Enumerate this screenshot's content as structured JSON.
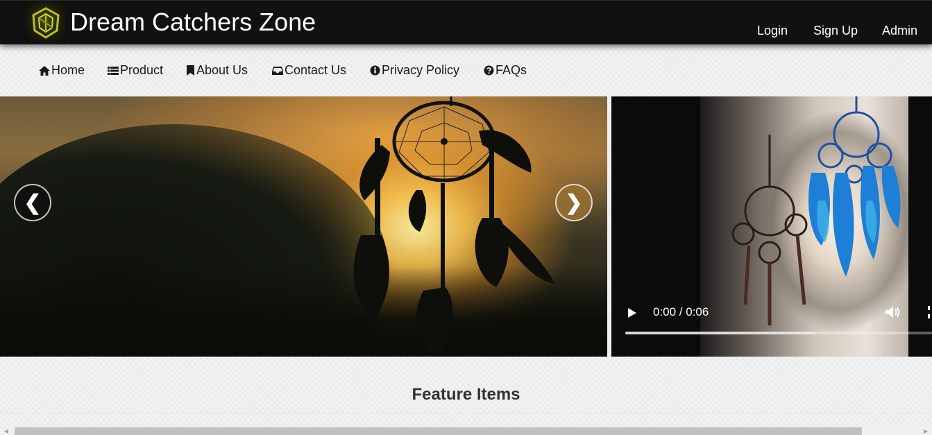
{
  "header": {
    "brand": "Dream Catchers Zone",
    "logo_icon": "dream-catchers-logo",
    "auth_links": [
      {
        "label": "Login",
        "name": "login-link"
      },
      {
        "label": "Sign Up",
        "name": "signup-link"
      },
      {
        "label": "Admin",
        "name": "admin-link"
      }
    ]
  },
  "nav": {
    "items": [
      {
        "label": "Home",
        "icon": "home-icon"
      },
      {
        "label": "Product",
        "icon": "list-icon"
      },
      {
        "label": "About Us",
        "icon": "bookmark-icon"
      },
      {
        "label": "Contact Us",
        "icon": "inbox-icon"
      },
      {
        "label": "Privacy Policy",
        "icon": "info-icon"
      },
      {
        "label": "FAQs",
        "icon": "question-icon"
      }
    ]
  },
  "carousel": {
    "prev_symbol": "❮",
    "next_symbol": "❯"
  },
  "video": {
    "time": "0:00 / 0:06",
    "buffered_fraction": 0.62
  },
  "main": {
    "feature_heading": "Feature Items"
  },
  "colors": {
    "topbar_bg": "#111111",
    "page_bg": "#f1f2f4",
    "text_dark": "#333333"
  }
}
